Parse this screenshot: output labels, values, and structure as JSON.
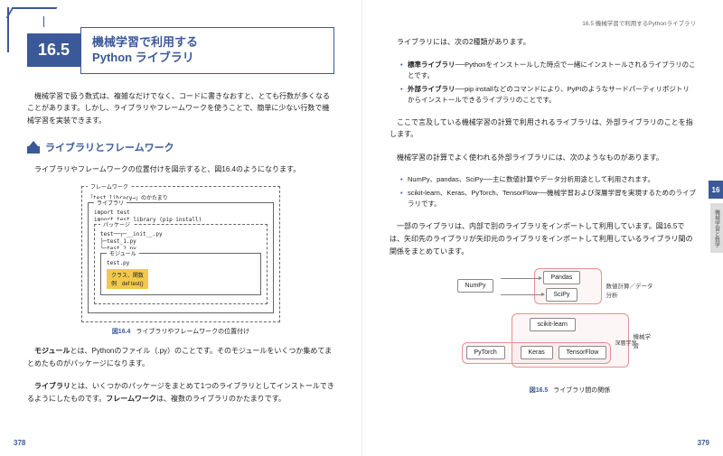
{
  "left": {
    "section_num": "16.5",
    "section_title_l1": "機械学習で利用する",
    "section_title_l2": "Python ライブラリ",
    "para1": "機械学習で扱う数式は、複雑なだけでなく、コードに書きなおすと、とても行数が多くなることがあります。しかし、ライブラリやフレームワークを使うことで、簡単に少ない行数で機械学習を実装できます。",
    "subsec1": "ライブラリとフレームワーク",
    "para2": "ライブラリやフレームワークの位置付けを図示すると、図16.4のようになります。",
    "fig164": {
      "fw": "フレームワーク",
      "fw_sub": "「test_library→」のかたまり",
      "lib": "ライブラリ",
      "lib_code1": "import test",
      "lib_code2": "import test_library (pip install)",
      "pkg": "パッケージ",
      "pkg_c1": "test──┬─__init__.py",
      "pkg_c2": "      ├─test_1.py",
      "pkg_c3": "      └─test_2.py",
      "mod": "モジュール",
      "mod_c": "test.py",
      "cls_l1": "クラス、関数",
      "cls_l2": "例　def test()",
      "caption_num": "図16.4",
      "caption_txt": "ライブラリやフレームワークの位置付け"
    },
    "para3a": "モジュール",
    "para3b": "とは、Pythonのファイル（.py）のことです。そのモジュールをいくつか集めてまとめたものがパッケージになります。",
    "para4a": "ライブラリ",
    "para4b": "とは、いくつかのパッケージをまとめて1つのライブラリとしてインストールできるようにしたものです。",
    "para4c": "フレームワーク",
    "para4d": "は、複数のライブラリのかたまりです。",
    "page_num": "378"
  },
  "right": {
    "crumb": "16.5 機械学習で利用するPythonライブラリ",
    "para1": "ライブラリには、次の2種類があります。",
    "b1_lead": "標準ライブラリ",
    "b1_txt": "──Pythonをインストールした時点で一緒にインストールされるライブラリのことです。",
    "b2_lead": "外部ライブラリ",
    "b2_txt": "──pip installなどのコマンドにより、PyPIのようなサードパーティリポジトリからインストールできるライブラリのことです。",
    "para2": "ここで言及している機械学習の計算で利用されるライブラリは、外部ライブラリのことを指します。",
    "para3": "機械学習の計算でよく使われる外部ライブラリには、次のようなものがあります。",
    "b3_txt": "NumPy、pandas、SciPy──主に数値計算やデータ分析用途として利用されます。",
    "b4_txt": "scikit-learn、Keras、PyTorch、TensorFlow──機械学習および深層学習を実現するためのライブラリです。",
    "para4": "一部のライブラリは、内部で別のライブラリをインポートして利用しています。図16.5では、矢印先のライブラリが矢印元のライブラリをインポートして利用しているライブラリ間の関係をまとめています。",
    "dg": {
      "numpy": "NumPy",
      "pandas": "Pandas",
      "scipy": "SciPy",
      "sklearn": "scikit-learn",
      "keras": "Keras",
      "pytorch": "PyTorch",
      "tf": "TensorFlow",
      "g1": "数値計算／データ分析",
      "g2": "機械学習",
      "g3": "深層学習",
      "caption_num": "図16.5",
      "caption_txt": "ライブラリ間の関係"
    },
    "tab": "16",
    "tab2": "機械学習と数学",
    "page_num": "379"
  }
}
